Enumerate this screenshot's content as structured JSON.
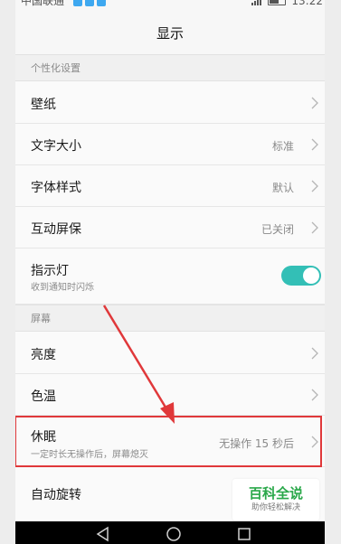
{
  "status_bar": {
    "carrier": "中国联通",
    "time": "13:22",
    "notification_icons": [
      "notification-icon",
      "notification-icon",
      "notification-icon"
    ],
    "signal_icon": "signal-icon",
    "battery_icon": "battery-icon"
  },
  "header": {
    "title": "显示"
  },
  "sections": {
    "personalization": {
      "title": "个性化设置",
      "items": [
        {
          "label": "壁纸",
          "value": "",
          "icon": "chevron-right-icon"
        },
        {
          "label": "文字大小",
          "value": "标准",
          "icon": "chevron-right-icon"
        },
        {
          "label": "字体样式",
          "value": "默认",
          "icon": "chevron-right-icon"
        },
        {
          "label": "互动屏保",
          "value": "已关闭",
          "icon": "chevron-right-icon"
        },
        {
          "label": "指示灯",
          "sublabel": "收到通知时闪烁",
          "toggle_on": true
        }
      ]
    },
    "screen": {
      "title": "屏幕",
      "items": [
        {
          "label": "亮度",
          "value": "",
          "icon": "chevron-right-icon"
        },
        {
          "label": "色温",
          "value": "",
          "icon": "chevron-right-icon"
        },
        {
          "label": "休眠",
          "sublabel": "一定时长无操作后，屏幕熄灭",
          "value": "无操作 15 秒后",
          "icon": "chevron-right-icon",
          "highlighted": true
        },
        {
          "label": "自动旋转"
        }
      ]
    }
  },
  "watermark": {
    "main": "百科全说",
    "sub": "助你轻松解决"
  },
  "nav": {
    "back_icon": "back-triangle-icon",
    "home_icon": "home-circle-icon",
    "recents_icon": "recents-square-icon"
  },
  "colors": {
    "accent_toggle": "#33bfb6",
    "highlight": "#e0383a",
    "watermark_green": "#2aa84a"
  }
}
